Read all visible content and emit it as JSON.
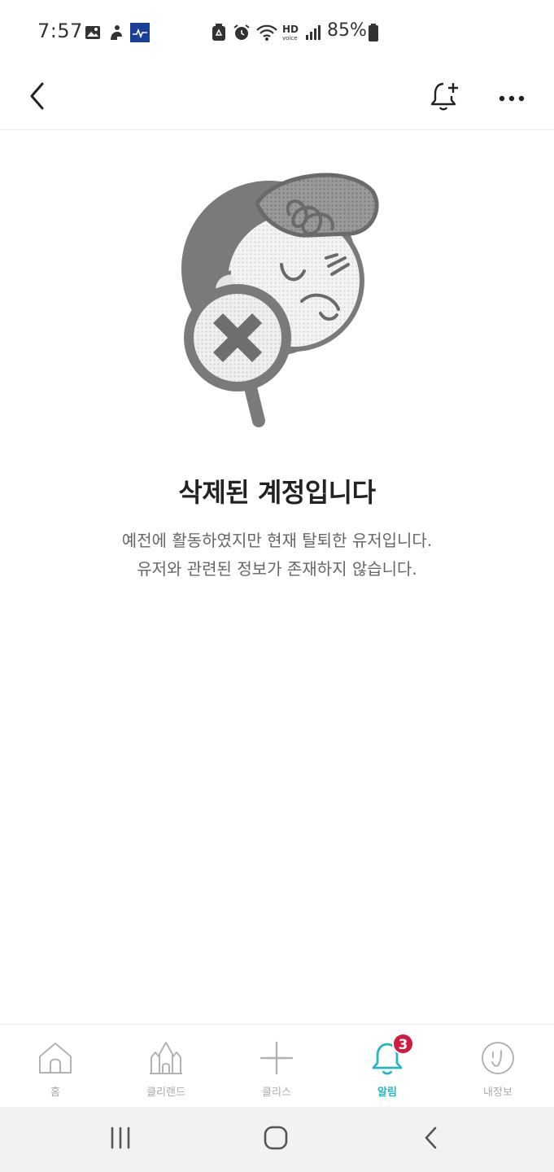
{
  "status_bar": {
    "time": "7:57",
    "battery": "85%",
    "left_icons": [
      "gallery-icon",
      "bixby-icon",
      "app-notification-icon"
    ],
    "right_icons": [
      "recycle-icon",
      "alarm-icon",
      "wifi-icon",
      "hd-voice-icon",
      "signal-icon",
      "battery-icon"
    ]
  },
  "header": {
    "back_icon": "chevron-left-icon",
    "alert_add_icon": "bell-plus-icon",
    "more_icon": "more-horizontal-icon"
  },
  "main": {
    "title": "삭제된 계정입니다",
    "description_line1": "예전에 활동하였지만 현재 탈퇴한 유저입니다.",
    "description_line2": "유저와 관련된 정보가 존재하지 않습니다."
  },
  "bottom_nav": {
    "items": [
      {
        "label": "홈",
        "icon": "home-icon",
        "active": false
      },
      {
        "label": "클리랜드",
        "icon": "castle-icon",
        "active": false
      },
      {
        "label": "클리스",
        "icon": "sparkle-icon",
        "active": false
      },
      {
        "label": "알림",
        "icon": "bell-icon",
        "active": true,
        "badge": "3"
      },
      {
        "label": "내정보",
        "icon": "profile-face-icon",
        "active": false
      }
    ]
  },
  "colors": {
    "accent": "#25b6c2",
    "badge": "#d11a3f",
    "inactive": "#aaaaaa"
  }
}
